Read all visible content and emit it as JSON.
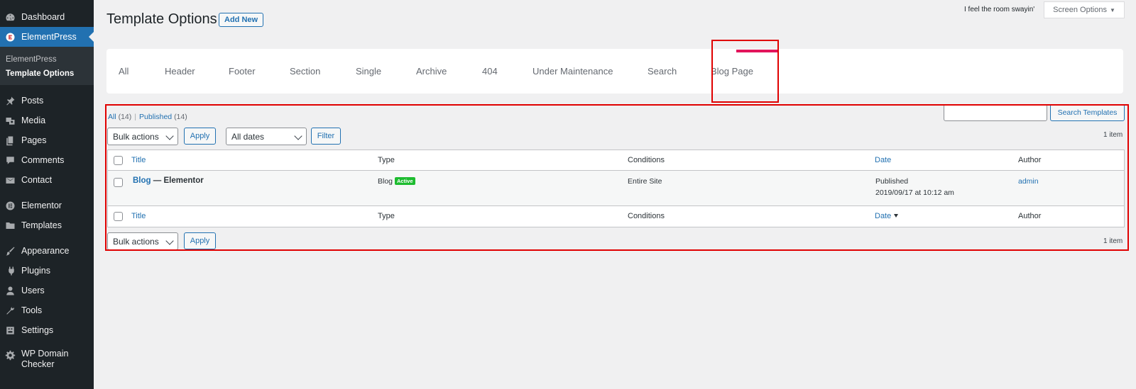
{
  "sidebar": {
    "items": [
      {
        "label": "Dashboard",
        "icon": "dashboard-icon"
      },
      {
        "label": "ElementPress",
        "icon": "elementpress-icon",
        "active": true
      },
      {
        "label": "Posts",
        "icon": "pin-icon"
      },
      {
        "label": "Media",
        "icon": "media-icon"
      },
      {
        "label": "Pages",
        "icon": "pages-icon"
      },
      {
        "label": "Comments",
        "icon": "comment-icon"
      },
      {
        "label": "Contact",
        "icon": "envelope-icon"
      },
      {
        "label": "Elementor",
        "icon": "elementor-icon"
      },
      {
        "label": "Templates",
        "icon": "folder-icon"
      },
      {
        "label": "Appearance",
        "icon": "paintbrush-icon"
      },
      {
        "label": "Plugins",
        "icon": "plug-icon"
      },
      {
        "label": "Users",
        "icon": "user-icon"
      },
      {
        "label": "Tools",
        "icon": "wrench-icon"
      },
      {
        "label": "Settings",
        "icon": "settings-icon"
      },
      {
        "label": "WP Domain Checker",
        "icon": "gear-icon"
      }
    ],
    "submenu": [
      "ElementPress",
      "Template Options"
    ]
  },
  "header": {
    "title": "Template Options",
    "add_new": "Add New",
    "lyric": "I feel the room swayin'",
    "screen_options": "Screen Options"
  },
  "tabs": [
    "All",
    "Header",
    "Footer",
    "Section",
    "Single",
    "Archive",
    "404",
    "Under Maintenance",
    "Search",
    "Blog Page"
  ],
  "active_tab": "Blog Page",
  "filters": {
    "all_label": "All",
    "all_count": "(14)",
    "published_label": "Published",
    "published_count": "(14)",
    "search_button": "Search Templates",
    "bulk_actions": "Bulk actions",
    "apply": "Apply",
    "all_dates": "All dates",
    "filter": "Filter",
    "items_count": "1 item"
  },
  "table": {
    "columns": {
      "title": "Title",
      "type": "Type",
      "conditions": "Conditions",
      "date": "Date",
      "author": "Author"
    },
    "rows": [
      {
        "title_link": "Blog",
        "title_rest": " — Elementor",
        "type": "Blog",
        "badge": "Active",
        "conditions": "Entire Site",
        "date_status": "Published",
        "date_value": "2019/09/17 at 10:12 am",
        "author": "admin"
      }
    ]
  },
  "colors": {
    "accent": "#2271b1",
    "sidebar_bg": "#1d2327",
    "tab_indicator": "#e2155b",
    "highlight": "#e00000",
    "badge": "#1ebc30"
  }
}
